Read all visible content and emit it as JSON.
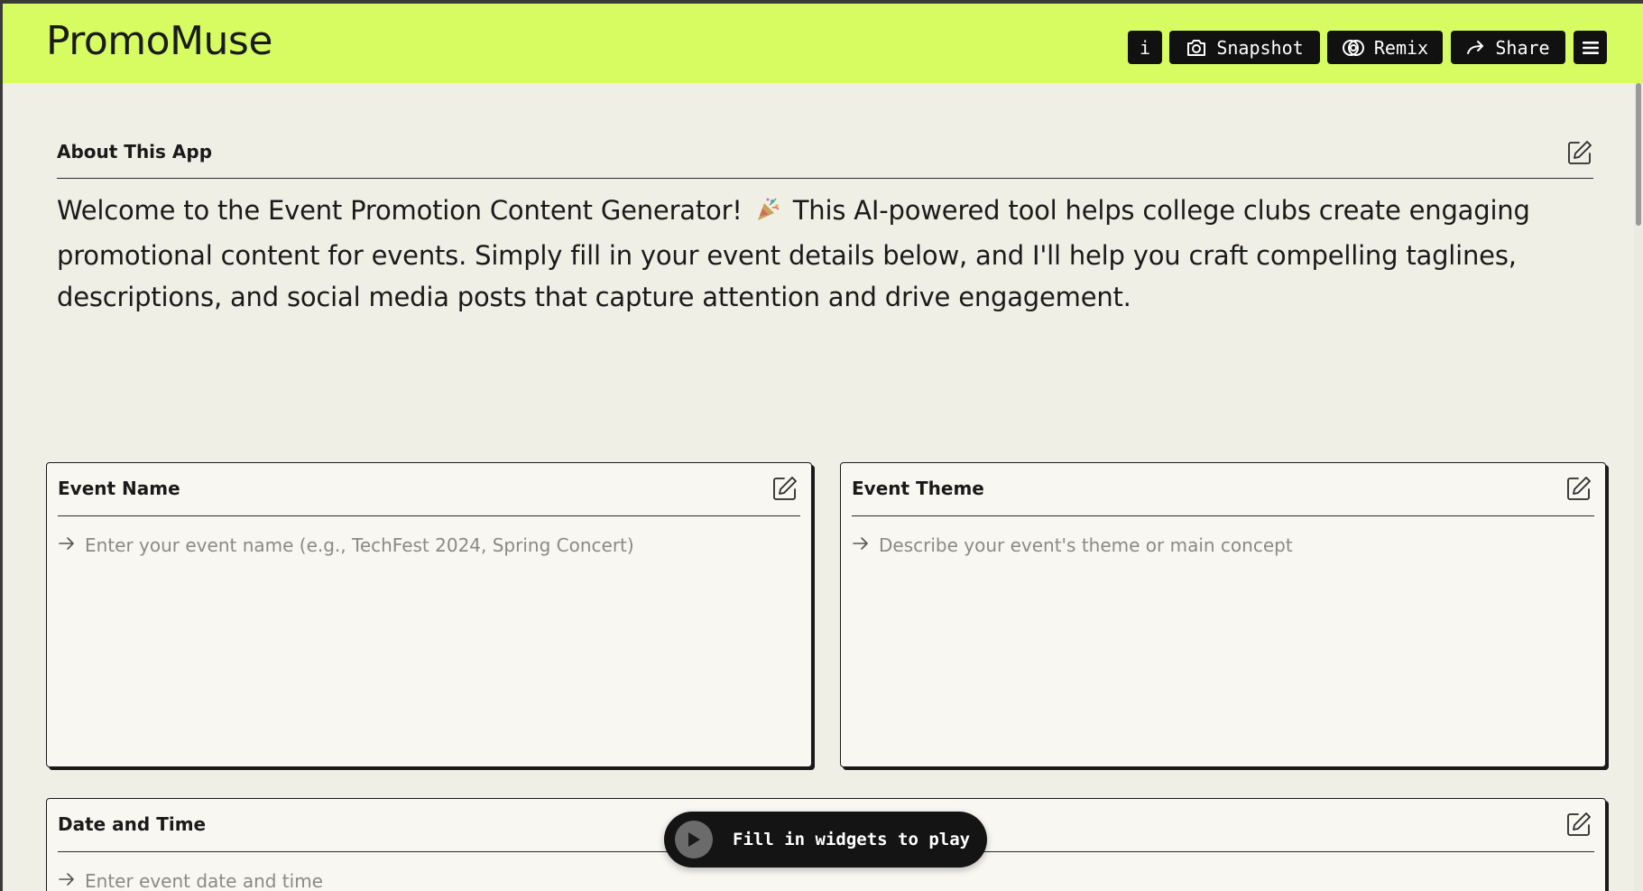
{
  "header": {
    "app_name": "PromoMuse",
    "info_label": "i",
    "snapshot_label": "Snapshot",
    "remix_label": "Remix",
    "share_label": "Share"
  },
  "about": {
    "label": "About This App",
    "text_before": "Welcome to the Event Promotion Content Generator!",
    "text_after": "This AI-powered tool helps college clubs create engaging promotional content for events. Simply fill in your event details below, and I'll help you craft compelling taglines, descriptions, and social media posts that capture attention and drive engagement."
  },
  "widgets": {
    "event_name": {
      "label": "Event Name",
      "placeholder": "Enter your event name (e.g., TechFest 2024, Spring Concert)"
    },
    "event_theme": {
      "label": "Event Theme",
      "placeholder": "Describe your event's theme or main concept"
    },
    "date_time": {
      "label": "Date and Time",
      "placeholder": "Enter event date and time"
    }
  },
  "play": {
    "label": "Fill in widgets to play"
  },
  "colors": {
    "header_bg": "#d6fc62",
    "page_bg": "#f0efe6",
    "button_bg": "#111111"
  }
}
